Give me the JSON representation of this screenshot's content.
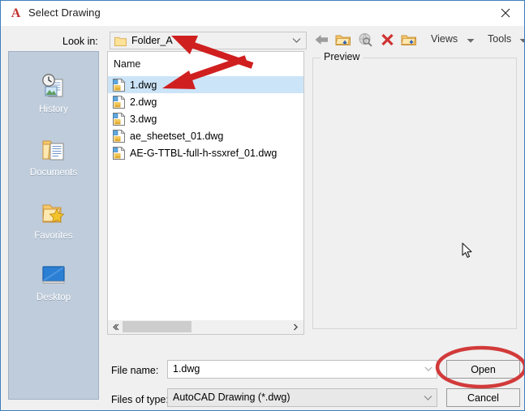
{
  "window": {
    "title": "Select Drawing",
    "logo_icon": "autocad-a-icon",
    "close_icon": "close-icon"
  },
  "lookin": {
    "label": "Look in:",
    "value": "Folder_A",
    "folder_icon": "folder-icon",
    "chevron_icon": "chevron-down-icon"
  },
  "toolbar": {
    "back": {
      "label": "Back",
      "icon": "back-arrow-icon"
    },
    "up": {
      "label": "Up one level",
      "icon": "up-folder-icon"
    },
    "search": {
      "label": "Search the Web",
      "icon": "search-web-icon"
    },
    "delete": {
      "label": "Delete",
      "icon": "delete-x-icon"
    },
    "newfolder": {
      "label": "Create New Folder",
      "icon": "new-folder-icon"
    },
    "views": {
      "label": "Views",
      "icon": "dropdown-arrow-icon"
    },
    "tools": {
      "label": "Tools",
      "icon": "dropdown-arrow-icon"
    }
  },
  "places": {
    "items": [
      {
        "label": "History",
        "icon": "history-icon"
      },
      {
        "label": "Documents",
        "icon": "documents-folder-icon"
      },
      {
        "label": "Favorites",
        "icon": "favorites-star-folder-icon"
      },
      {
        "label": "Desktop",
        "icon": "desktop-monitor-icon"
      }
    ]
  },
  "filelist": {
    "column_header": "Name",
    "selected_index": 0,
    "files": [
      {
        "name": "1.dwg",
        "icon": "dwg-file-icon"
      },
      {
        "name": "2.dwg",
        "icon": "dwg-file-icon"
      },
      {
        "name": "3.dwg",
        "icon": "dwg-file-icon"
      },
      {
        "name": "ae_sheetset_01.dwg",
        "icon": "dwg-file-icon"
      },
      {
        "name": "AE-G-TTBL-full-h-ssxref_01.dwg",
        "icon": "dwg-file-icon"
      }
    ],
    "scroll_left_icon": "scroll-left-icon",
    "scroll_right_icon": "scroll-right-icon"
  },
  "preview": {
    "legend": "Preview",
    "content": ""
  },
  "bottom": {
    "filename_label": "File name:",
    "filename_value": "1.dwg",
    "filename_placeholder": "",
    "filetype_label": "Files of type:",
    "filetype_value": "AutoCAD Drawing (*.dwg)",
    "open_label": "Open",
    "cancel_label": "Cancel"
  },
  "annotations": {
    "color": "#d01f1f",
    "ellipse_color": "#d23a3a",
    "arrow_to_lookin": "red-arrow-icon",
    "arrow_to_file": "red-arrow-icon",
    "highlight_open": "red-ellipse-icon"
  },
  "cursor": {
    "icon": "mouse-pointer-icon"
  }
}
